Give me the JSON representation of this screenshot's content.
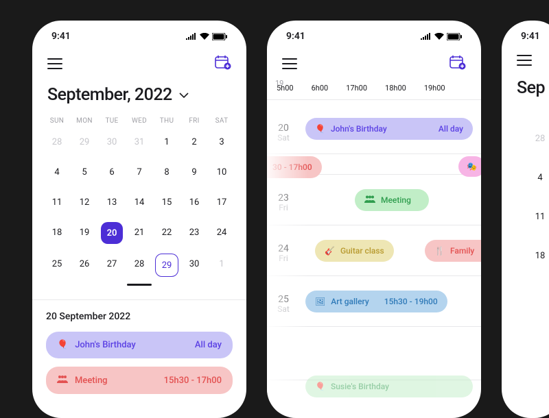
{
  "status": {
    "time": "9:41"
  },
  "phone1": {
    "title": "September, 2022",
    "dow": [
      "SUN",
      "MON",
      "TUE",
      "WED",
      "THU",
      "FRI",
      "SAT"
    ],
    "grid_prev": [
      "28",
      "29",
      "30",
      "31"
    ],
    "grid_curr": [
      "1",
      "2",
      "3",
      "4",
      "5",
      "6",
      "7",
      "8",
      "9",
      "10",
      "11",
      "12",
      "13",
      "14",
      "15",
      "16",
      "17",
      "18",
      "19",
      "20",
      "21",
      "22",
      "23",
      "24",
      "25",
      "26",
      "27",
      "28",
      "29",
      "30"
    ],
    "grid_next": [
      "1"
    ],
    "selected_day": "20",
    "outlined_day": "29",
    "section_title": "20 September 2022",
    "events": [
      {
        "icon": "balloons",
        "label": "John's Birthday",
        "time": "All day",
        "tone": "purple"
      },
      {
        "icon": "people",
        "label": "Meeting",
        "time": "15h30 - 17h00",
        "tone": "red"
      }
    ]
  },
  "phone2": {
    "prev_row_num": "19",
    "time_labels": [
      "5h00",
      "6h00",
      "17h00",
      "18h00",
      "19h00"
    ],
    "rows": [
      {
        "num": "20",
        "dow": "Sat"
      },
      {
        "num": "23",
        "dow": "Fri"
      },
      {
        "num": "24",
        "dow": "Fri"
      },
      {
        "num": "25",
        "dow": "Sat"
      }
    ],
    "events": [
      {
        "label": "John's Birthday",
        "time": "All day",
        "tone": "purple",
        "icon": "balloons"
      },
      {
        "label": "30 - 17h00",
        "tone": "red"
      },
      {
        "label": "",
        "tone": "pink",
        "icon": "masks"
      },
      {
        "label": "Meeting",
        "tone": "green",
        "icon": "people"
      },
      {
        "label": "Guitar class",
        "tone": "yellow",
        "icon": "guitar"
      },
      {
        "label": "Family",
        "tone": "red",
        "icon": "food"
      },
      {
        "label": "Art gallery",
        "time": "15h30 - 19h00",
        "tone": "blue",
        "icon": "image"
      },
      {
        "label": "Susie's Birthday",
        "tone": "green",
        "icon": "balloons"
      }
    ]
  },
  "phone3": {
    "title_partial": "Sep",
    "visible_days": [
      "28",
      "4",
      "11",
      "18"
    ]
  }
}
